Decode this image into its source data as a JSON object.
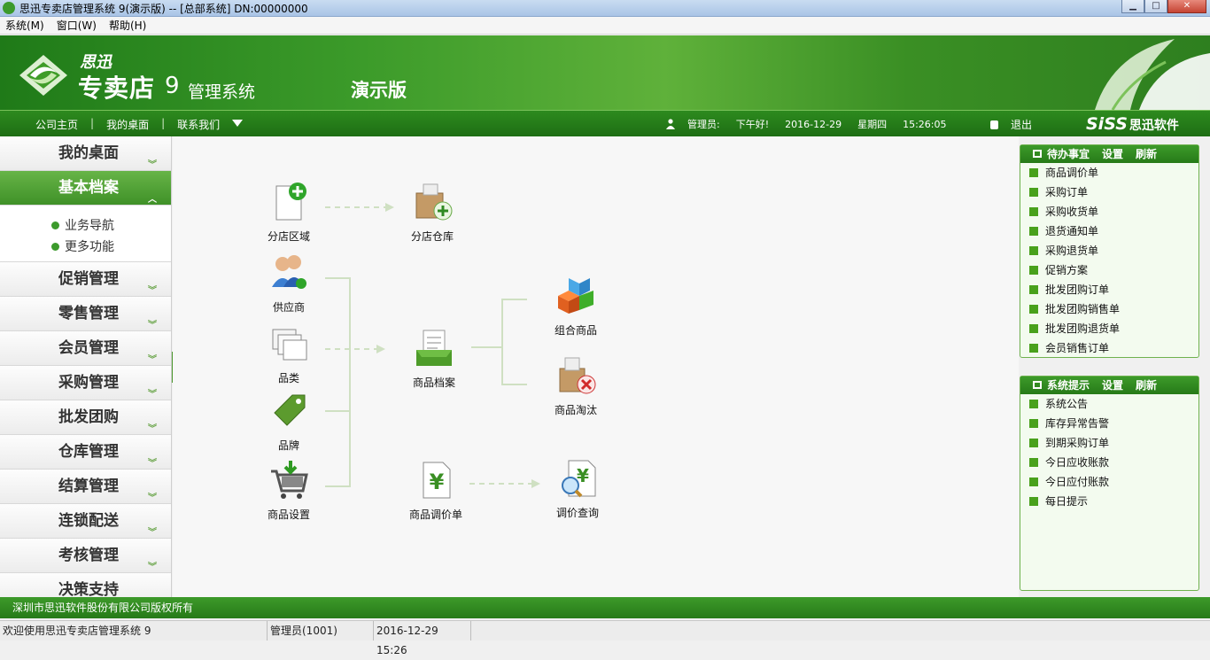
{
  "window": {
    "title": "思迅专卖店管理系统 9(演示版) -- [总部系统] DN:00000000"
  },
  "menubar": [
    "系统(M)",
    "窗口(W)",
    "帮助(H)"
  ],
  "banner": {
    "brand_small": "思迅",
    "brand_main": "专卖店",
    "brand_num": "9",
    "brand_sub": "管理系统",
    "edition": "演示版"
  },
  "nav": {
    "links": [
      "公司主页",
      "我的桌面",
      "联系我们"
    ],
    "user_label": "管理员:",
    "greeting": "下午好!",
    "date": "2016-12-29",
    "weekday": "星期四",
    "time": "15:26:05",
    "logout": "退出",
    "company_logo": "SiSS",
    "company_name": "思迅软件"
  },
  "sidebar": {
    "items_top": [
      {
        "label": "我的桌面"
      },
      {
        "label": "基本档案",
        "active": true
      }
    ],
    "subitems": [
      "业务导航",
      "更多功能"
    ],
    "items_bottom": [
      "促销管理",
      "零售管理",
      "会员管理",
      "采购管理",
      "批发团购",
      "仓库管理",
      "结算管理",
      "连锁配送",
      "考核管理",
      "决策支持"
    ]
  },
  "flow": {
    "branch_area": "分店区域",
    "branch_warehouse": "分店仓库",
    "supplier": "供应商",
    "category": "品类",
    "brand": "品牌",
    "product_setup": "商品设置",
    "product_file": "商品档案",
    "bundle": "组合商品",
    "eliminate": "商品淘汰",
    "price_adjust": "商品调价单",
    "price_query": "调价查询"
  },
  "todo_panel": {
    "title": "待办事宜",
    "settings": "设置",
    "refresh": "刷新",
    "items": [
      "商品调价单",
      "采购订单",
      "采购收货单",
      "退货通知单",
      "采购退货单",
      "促销方案",
      "批发团购订单",
      "批发团购销售单",
      "批发团购退货单",
      "会员销售订单"
    ]
  },
  "system_panel": {
    "title": "系统提示",
    "settings": "设置",
    "refresh": "刷新",
    "items": [
      "系统公告",
      "库存异常告警",
      "到期采购订单",
      "今日应收账款",
      "今日应付账款",
      "每日提示"
    ]
  },
  "copyright": "深圳市思迅软件股份有限公司版权所有",
  "status": {
    "welcome": "欢迎使用思迅专卖店管理系统 9",
    "user": "管理员(1001)",
    "datetime": "2016-12-29 15:26"
  },
  "colors": {
    "brand_green": "#2d8a1e",
    "accent_green": "#49a11c"
  }
}
